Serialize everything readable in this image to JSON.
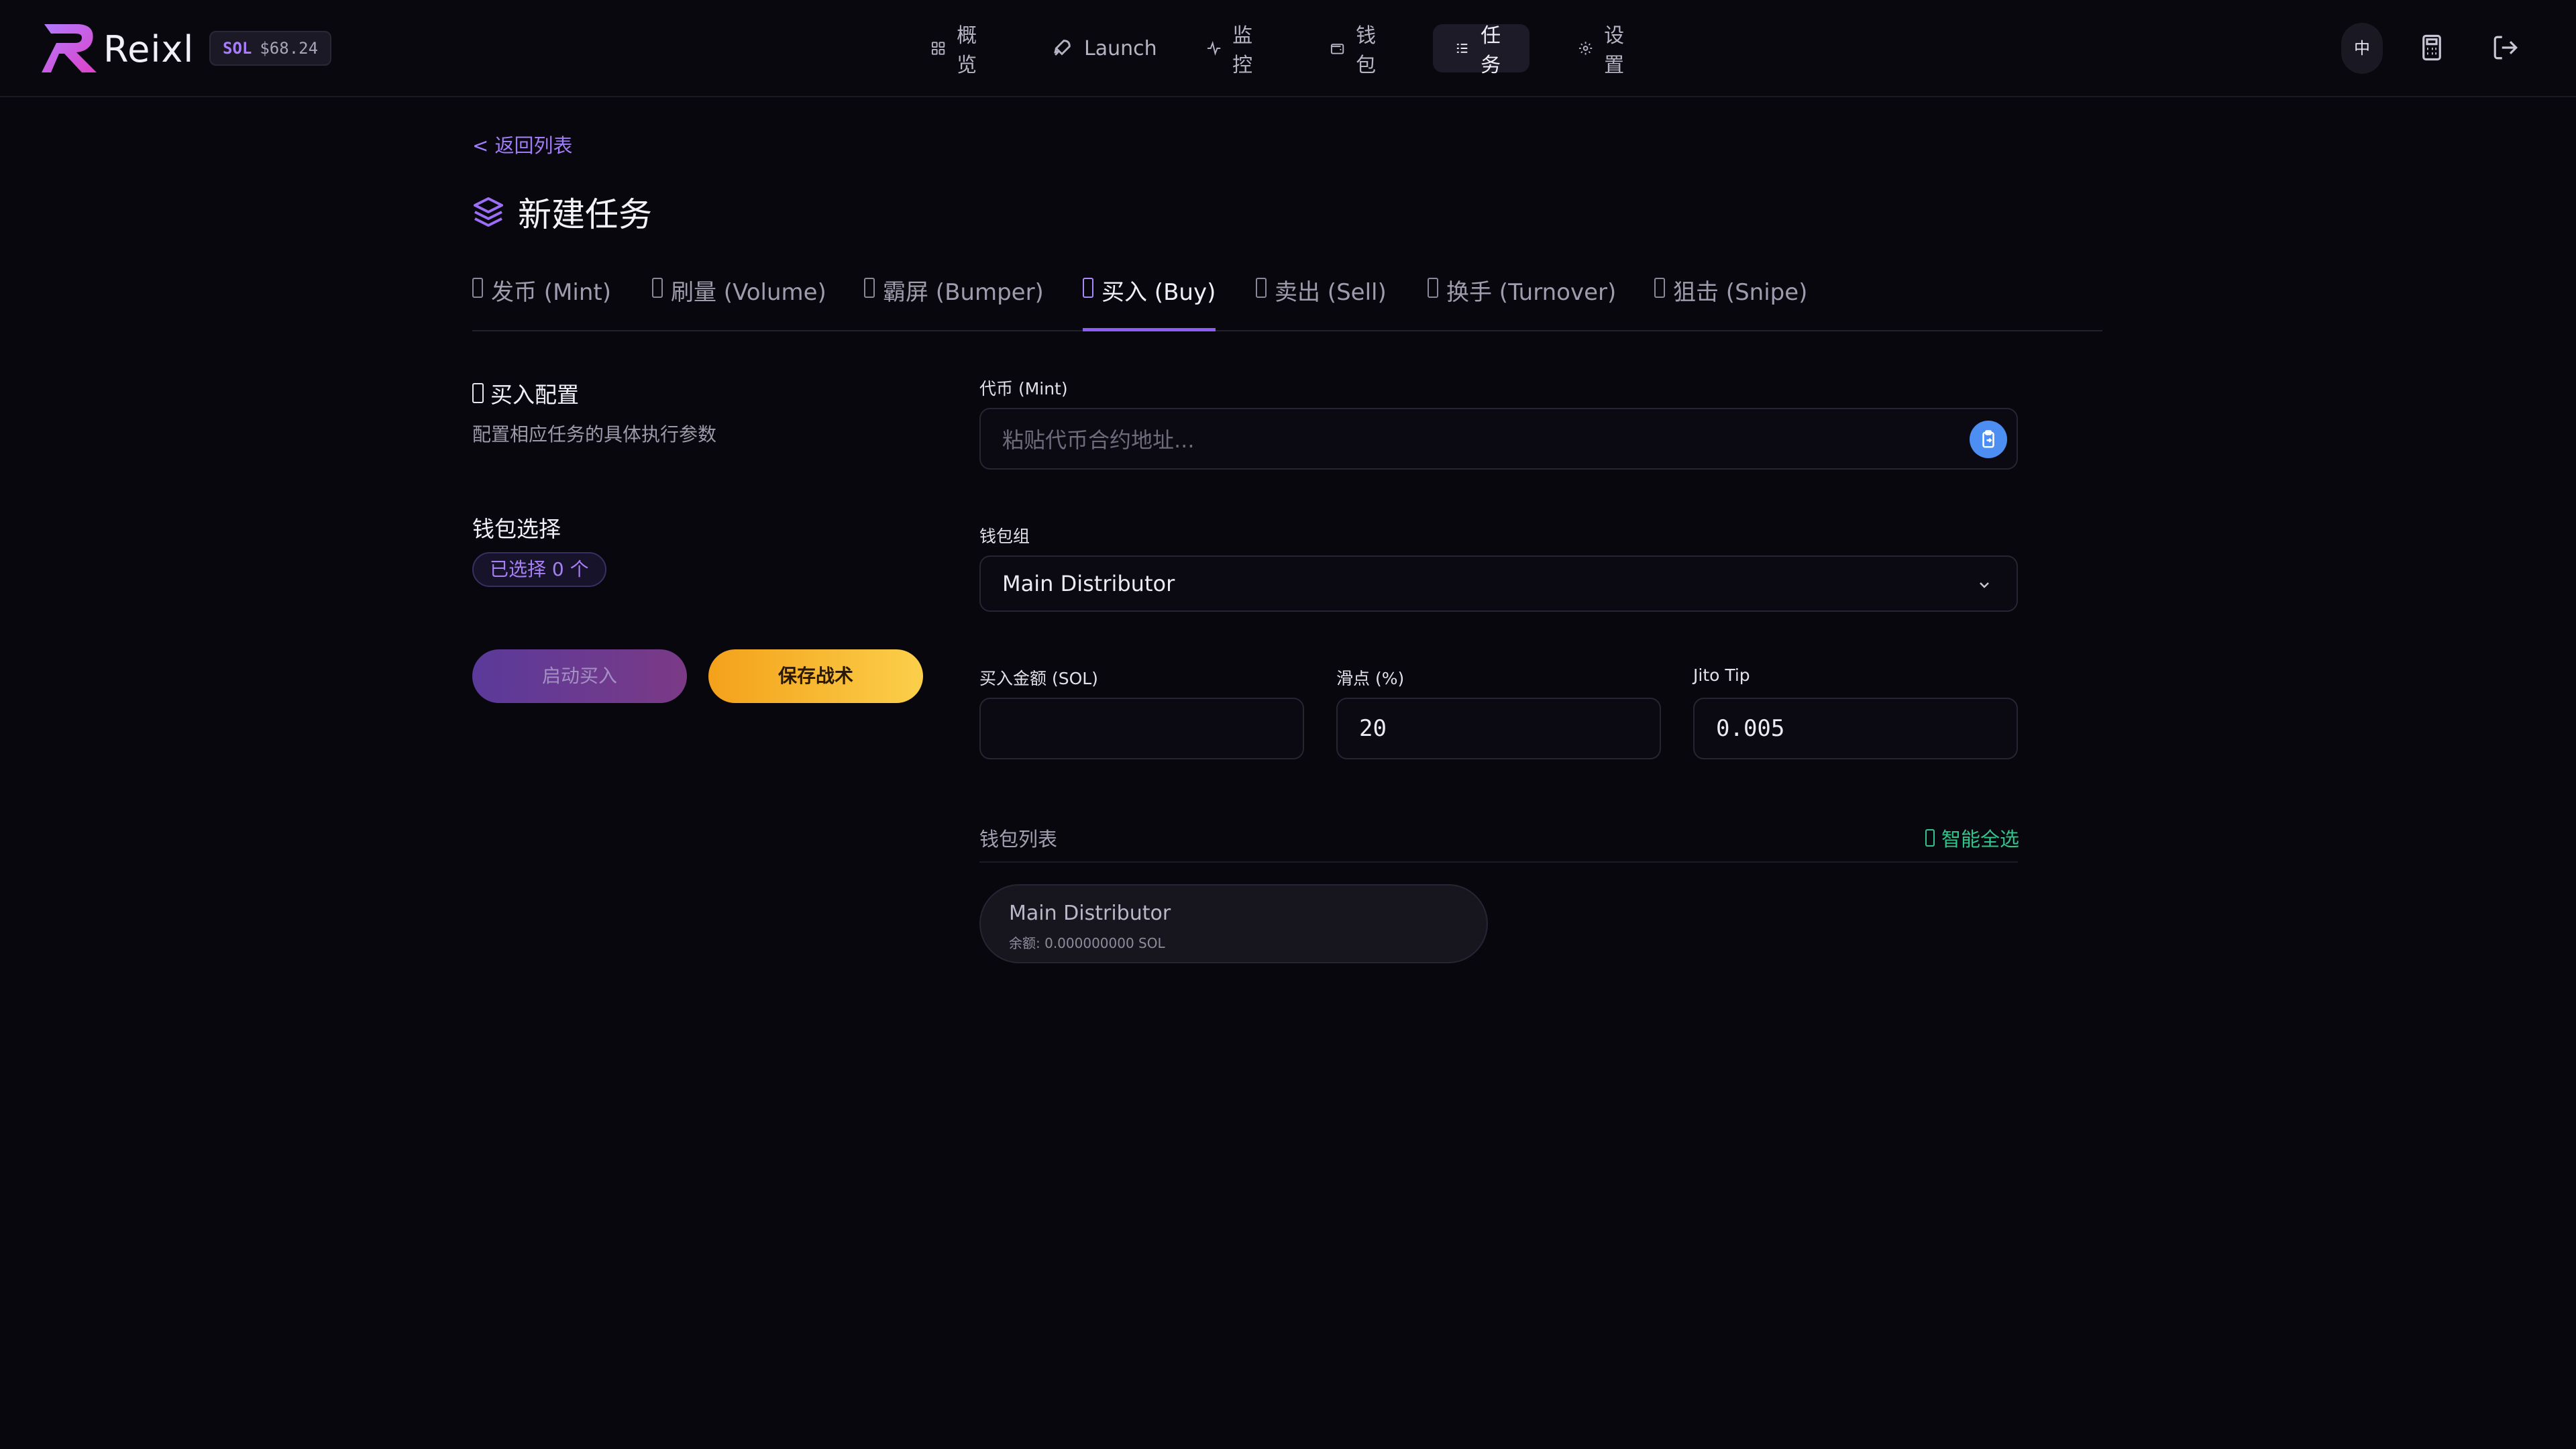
{
  "app": {
    "brand": "Reixl",
    "sol_symbol": "SOL",
    "sol_price": "$68.24",
    "accent_color": "#8b5cf6",
    "save_color": "#f5b026"
  },
  "nav": {
    "items": [
      {
        "label": "概览",
        "icon": "grid-icon"
      },
      {
        "label": "Launch",
        "icon": "rocket-icon"
      },
      {
        "label": "监控",
        "icon": "activity-icon"
      },
      {
        "label": "钱包",
        "icon": "wallet-icon"
      },
      {
        "label": "任务",
        "icon": "list-icon",
        "active": true
      },
      {
        "label": "设置",
        "icon": "gear-icon"
      }
    ]
  },
  "header_right": {
    "lang_label": "中",
    "calculator_icon": "calculator-icon",
    "logout_icon": "logout-icon"
  },
  "page": {
    "back_label": "< 返回列表",
    "title": "新建任务"
  },
  "tabs": [
    {
      "label": "发币 (Mint)"
    },
    {
      "label": "刷量 (Volume)"
    },
    {
      "label": "霸屏 (Bumper)"
    },
    {
      "label": "买入 (Buy)",
      "active": true
    },
    {
      "label": "卖出 (Sell)"
    },
    {
      "label": "换手 (Turnover)"
    },
    {
      "label": "狙击 (Snipe)"
    }
  ],
  "config": {
    "title": "买入配置",
    "subtitle": "配置相应任务的具体执行参数",
    "wallet_select_title": "钱包选择",
    "selected_count": "已选择 0 个",
    "start_button": "启动买入",
    "save_button": "保存战术"
  },
  "form": {
    "mint_label": "代币 (Mint)",
    "mint_placeholder": "粘贴代币合约地址...",
    "wallet_group_label": "钱包组",
    "wallet_group_value": "Main Distributor",
    "buy_amount_label": "买入金额 (SOL)",
    "buy_amount_value": "",
    "slippage_label": "滑点 (%)",
    "slippage_value": "20",
    "jito_label": "Jito Tip",
    "jito_value": "0.005"
  },
  "wallet_list": {
    "label": "钱包列表",
    "smart_select": "智能全选",
    "wallets": [
      {
        "name": "Main Distributor",
        "balance": "余额: 0.000000000 SOL"
      }
    ]
  }
}
